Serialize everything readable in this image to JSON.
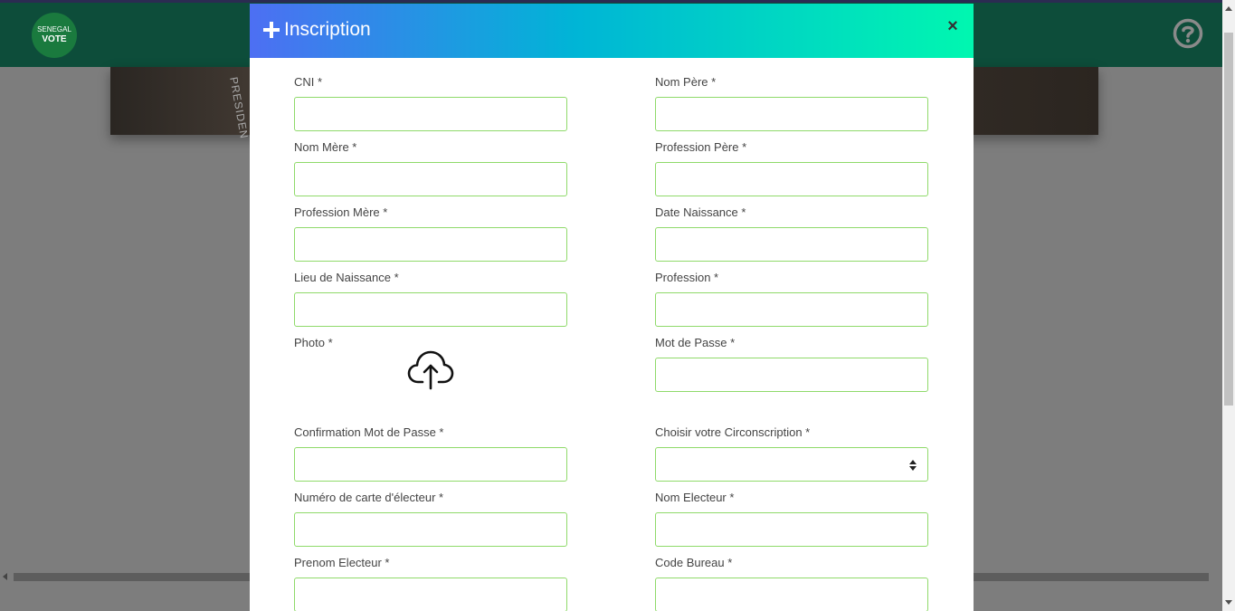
{
  "app": {
    "logo_line1": "SENEGAL",
    "logo_line2": "VOTE",
    "help_icon": "question-circle-icon",
    "hero_text": "PRESIDEN"
  },
  "modal": {
    "title": "Inscription",
    "title_icon": "plus-icon",
    "close_label": "×",
    "colors": {
      "gradient_start": "#4d6ff3",
      "gradient_mid": "#00b5d6",
      "gradient_end": "#00f7b0",
      "input_border": "#8fda6a"
    }
  },
  "form": {
    "cni": {
      "label": "CNI *",
      "value": ""
    },
    "nom_pere": {
      "label": "Nom Père *",
      "value": ""
    },
    "nom_mere": {
      "label": "Nom Mère *",
      "value": ""
    },
    "profession_pere": {
      "label": "Profession Père *",
      "value": ""
    },
    "profession_mere": {
      "label": "Profession Mère *",
      "value": ""
    },
    "date_naissance": {
      "label": "Date Naissance *",
      "value": ""
    },
    "lieu_naissance": {
      "label": "Lieu de Naissance *",
      "value": ""
    },
    "profession": {
      "label": "Profession *",
      "value": ""
    },
    "photo": {
      "label": "Photo *",
      "icon": "cloud-upload-icon"
    },
    "mot_de_passe": {
      "label": "Mot de Passe *",
      "value": ""
    },
    "confirmation_mot_de_passe": {
      "label": "Confirmation Mot de Passe *",
      "value": ""
    },
    "circonscription": {
      "label": "Choisir votre Circonscription *",
      "value": ""
    },
    "numero_carte": {
      "label": "Numéro de carte d'électeur *",
      "value": ""
    },
    "nom_electeur": {
      "label": "Nom Electeur *",
      "value": ""
    },
    "prenom_electeur": {
      "label": "Prenom Electeur *",
      "value": ""
    },
    "code_bureau": {
      "label": "Code Bureau *",
      "value": ""
    }
  }
}
